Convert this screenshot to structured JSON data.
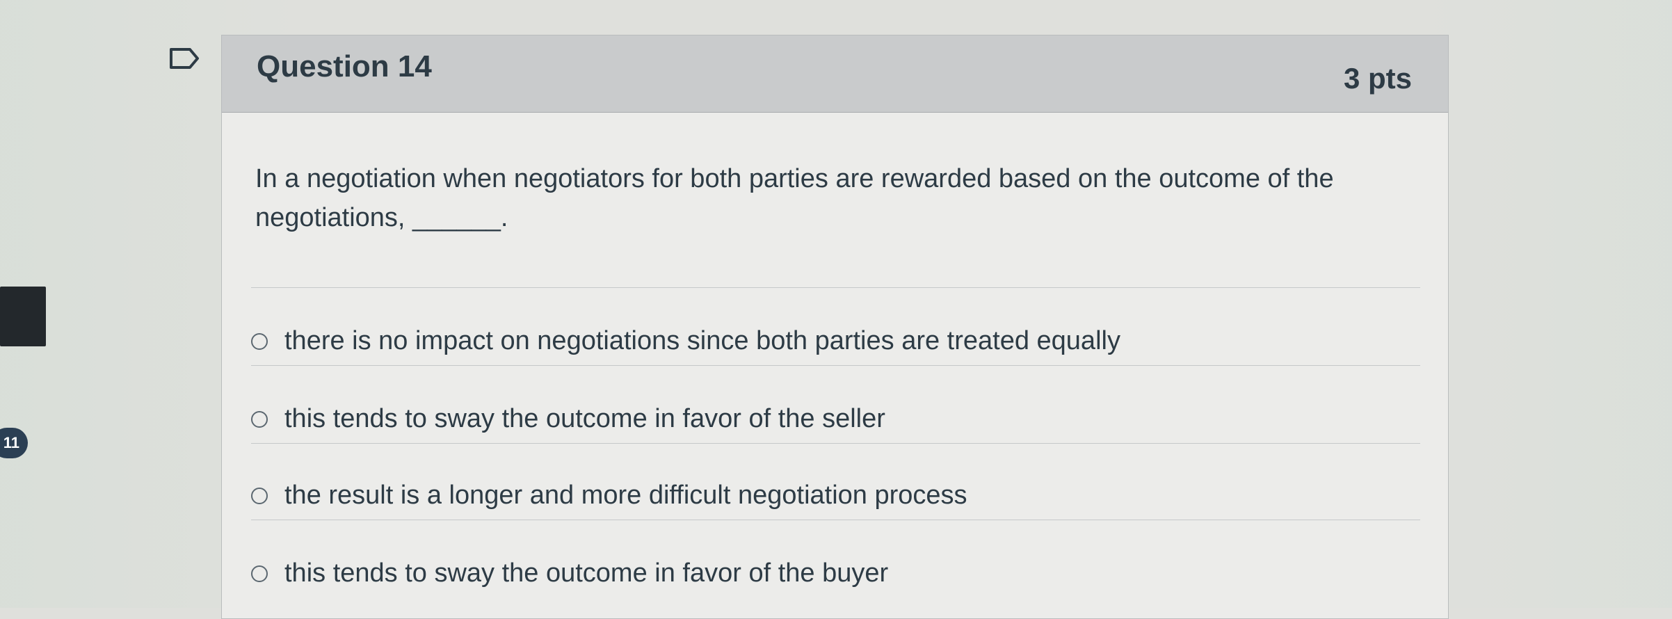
{
  "question": {
    "title": "Question 14",
    "points": "3 pts",
    "text": "In a negotiation when negotiators for both parties are rewarded based on the outcome of the negotiations, ______.",
    "flag_icon": "flag-icon"
  },
  "answers": [
    {
      "label": "there is no impact on negotiations since both parties are treated equally"
    },
    {
      "label": "this tends to sway the outcome in favor of the seller"
    },
    {
      "label": "the result is a longer and more difficult negotiation process"
    },
    {
      "label": "this tends to sway the outcome in favor of the buyer"
    }
  ],
  "nav": {
    "badge": "11"
  }
}
